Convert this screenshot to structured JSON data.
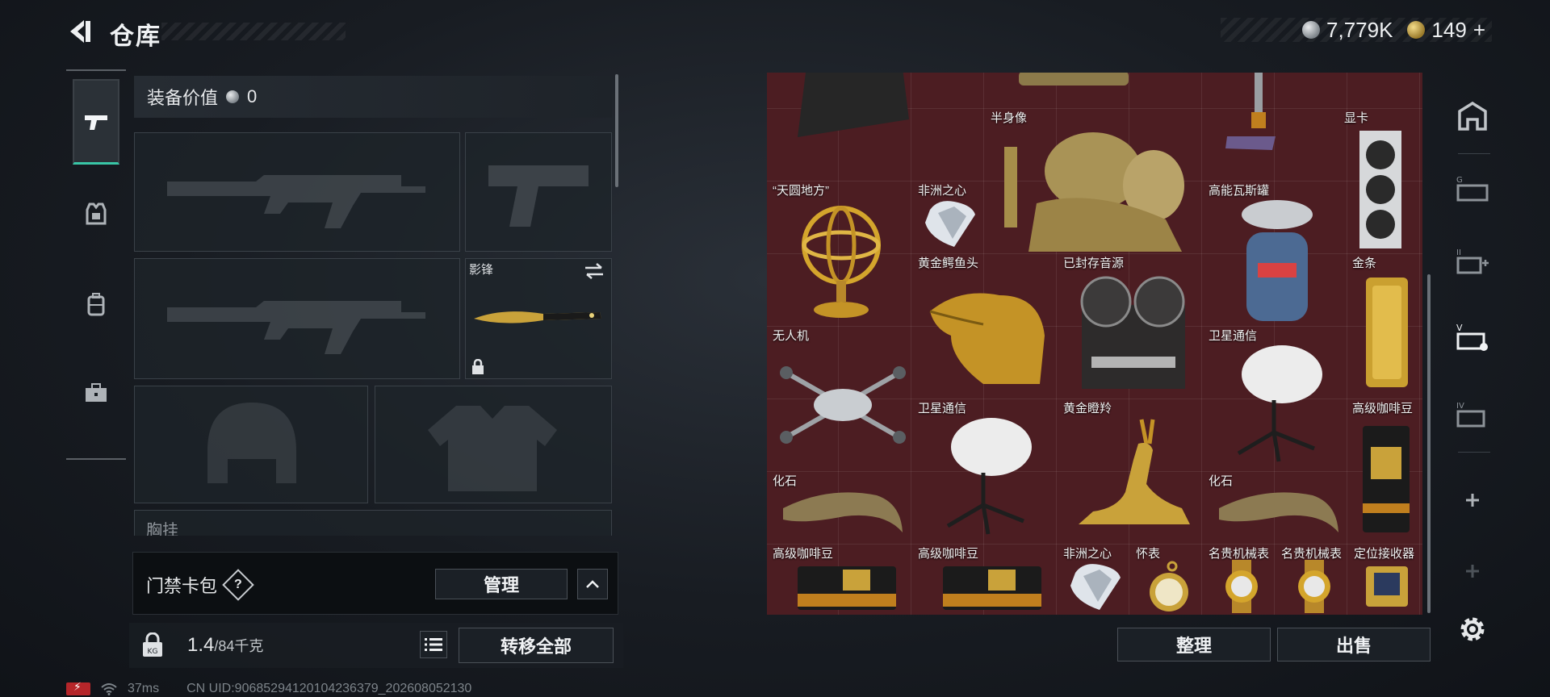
{
  "header": {
    "title": "仓库"
  },
  "currency": {
    "silver": "7,779K",
    "gold": "149",
    "gold_add": "+"
  },
  "left_nav": [
    "weapon-tab",
    "armor-tab",
    "backpack-tab",
    "container-tab"
  ],
  "equipment": {
    "value_label": "装备价值",
    "value_amount": "0",
    "melee_name": "影锋",
    "chest_label": "胸挂"
  },
  "keycard": {
    "title": "门禁卡包",
    "help": "?",
    "manage_label": "管理"
  },
  "weight": {
    "current": "1.4",
    "max": "/84千克"
  },
  "transfer_label": "转移全部",
  "status": {
    "ping": "37ms",
    "uid": "CN UID:9068529412010423637​9_202608052130"
  },
  "inventory_items": [
    {
      "label": "半身像"
    },
    {
      "label": "显卡"
    },
    {
      "label": "“天圆地方”"
    },
    {
      "label": "非洲之心"
    },
    {
      "label": "高能瓦斯罐"
    },
    {
      "label": "黄金鳄鱼头"
    },
    {
      "label": "已封存音源"
    },
    {
      "label": "金条"
    },
    {
      "label": "无人机"
    },
    {
      "label": "卫星通信"
    },
    {
      "label": "卫星通信"
    },
    {
      "label": "黄金瞪羚"
    },
    {
      "label": "高级咖啡豆"
    },
    {
      "label": "化石"
    },
    {
      "label": "化石"
    },
    {
      "label": "高级咖啡豆"
    },
    {
      "label": "高级咖啡豆"
    },
    {
      "label": "非洲之心"
    },
    {
      "label": "怀表"
    },
    {
      "label": "名贵机械表"
    },
    {
      "label": "名贵机械表"
    },
    {
      "label": "定位接收器"
    }
  ],
  "actions": {
    "sort_label": "整理",
    "sell_label": "出售"
  },
  "colors": {
    "accent_teal": "#39c6a7",
    "grid_bg": "#4c1d22",
    "gold": "#c9a23a"
  }
}
